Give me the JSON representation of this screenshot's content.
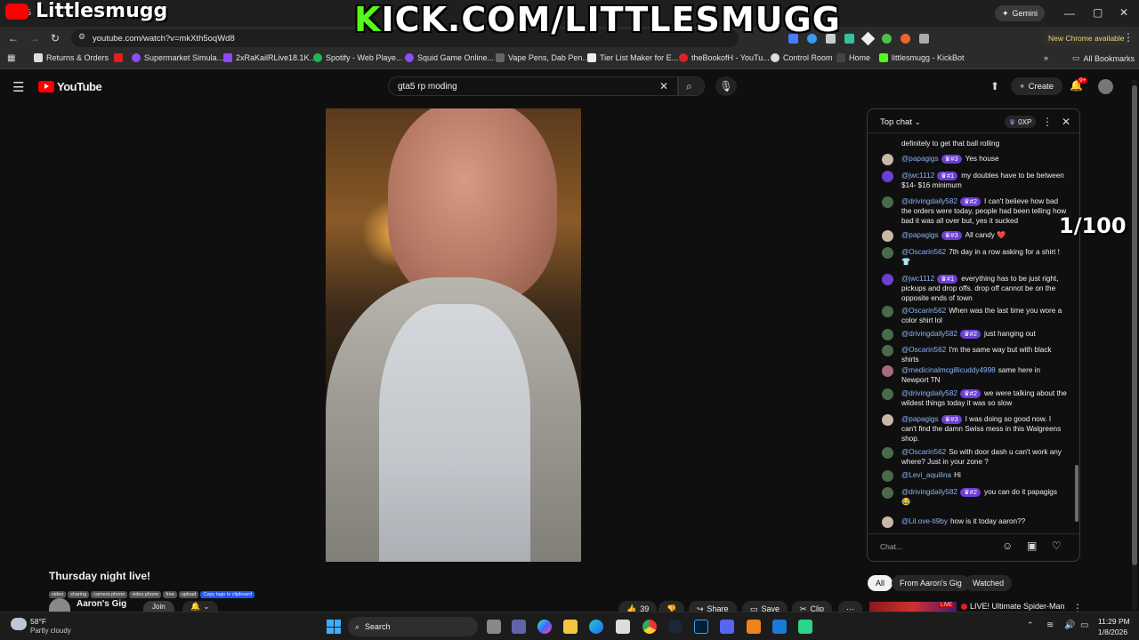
{
  "overlay": {
    "brand": "Littlesmugg",
    "kick_url_k": "K",
    "kick_url_rest": "ICK.COM/LITTLESMUGG",
    "counter": "1/100"
  },
  "browser": {
    "tab_count": "5",
    "gemini_label": "Gemini",
    "address": "youtube.com/watch?v=mkXth5oqWd8",
    "new_chrome": "New Chrome available",
    "bookmarks": [
      "Returns & Orders",
      "Supermarket Simula...",
      "2xRaKailRLive18.1K...",
      "Spotify - Web Playe...",
      "Squid Game Online...",
      "Vape Pens, Dab Pen...",
      "Tier List Maker for E...",
      "theBookofH - YouTu...",
      "Control Room",
      "Home",
      "littlesmugg - KickBot"
    ],
    "all_bookmarks": "All Bookmarks"
  },
  "youtube": {
    "logo": "YouTube",
    "search_value": "gta5 rp moding",
    "create_label": "Create",
    "notif_badge": "9+",
    "title": "Thursday night live!",
    "tags": [
      "video",
      "sharing",
      "camera phone",
      "video phone",
      "free",
      "upload"
    ],
    "copy_tags": "Copy tags to clipboard",
    "channel": "Aaron's Gig",
    "join": "Join",
    "likes": "39",
    "share": "Share",
    "save": "Save",
    "clip": "Clip",
    "filters": [
      "All",
      "From Aaron's Gig",
      "Watched"
    ],
    "rec_title": "LIVE! Ultimate Spider-Man",
    "rec_live": "LIVE"
  },
  "chat": {
    "header": "Top chat",
    "xp": "0XP",
    "placeholder": "Chat...",
    "top_text": "definitely to get that ball rolling",
    "messages": [
      {
        "author": "@papagigs",
        "badge": "#3",
        "text": "Yes house"
      },
      {
        "author": "@jwc1112",
        "badge": "#1",
        "text": "my doubles have to be between $14- $16 minimum"
      },
      {
        "author": "@drivingdaily582",
        "badge": "#2",
        "text": "I can't believe how bad the orders were today, people had been telling how bad it was all over but, yes it sucked"
      },
      {
        "author": "@papagigs",
        "badge": "#3",
        "text": "All candy ❤️"
      },
      {
        "author": "@Oscarin562",
        "badge": "",
        "text": "7th day in a row asking for a shirt ! 👕"
      },
      {
        "author": "@jwc1112",
        "badge": "#1",
        "text": "everything has to be just right, pickups and drop offs. drop off cannot be on the opposite ends of town"
      },
      {
        "author": "@Oscarin562",
        "badge": "",
        "text": "When was the last time you wore a color shirt lol"
      },
      {
        "author": "@drivingdaily582",
        "badge": "#2",
        "text": "just hanging out"
      },
      {
        "author": "@Oscarin562",
        "badge": "",
        "text": "I'm the same way but with black shirts"
      },
      {
        "author": "@medicinalmcgillicuddy4998",
        "badge": "",
        "text": "same here in Newport TN"
      },
      {
        "author": "@drivingdaily582",
        "badge": "#2",
        "text": "we were talking about the wildest things today it was so slow"
      },
      {
        "author": "@papagigs",
        "badge": "#3",
        "text": "I was doing so good now. I can't find the damn Swiss mess in this Walgreens shop."
      },
      {
        "author": "@Oscarin562",
        "badge": "",
        "text": "So with door dash u can't work any where? Just in your zone ?"
      },
      {
        "author": "@Levi_aquilina",
        "badge": "",
        "text": "Hi"
      },
      {
        "author": "@drivingdaily582",
        "badge": "#2",
        "text": "you can do it papagigs 😂"
      },
      {
        "author": "@Lil.ove-ti9by",
        "badge": "",
        "text": "how is it today aaron??"
      }
    ]
  },
  "taskbar": {
    "temp": "58°F",
    "weather": "Partly cloudy",
    "search": "Search",
    "time": "11:29 PM",
    "date": "1/8/2026"
  }
}
